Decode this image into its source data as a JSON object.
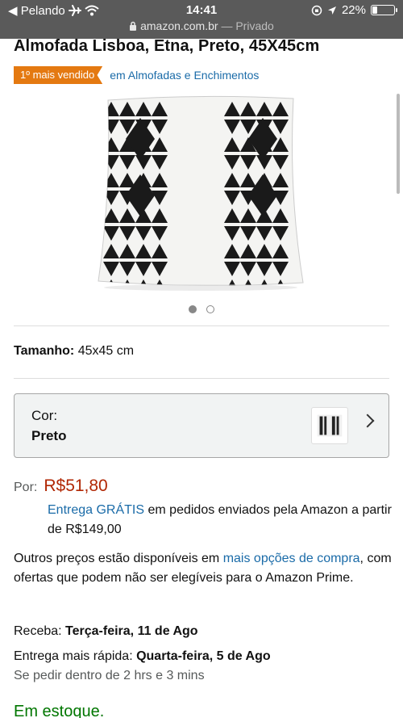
{
  "status_bar": {
    "carrier": "◀ Pelando",
    "time": "14:41",
    "battery": "22%",
    "battery_level": 0.22,
    "url": "amazon.com.br",
    "privacy": "— Privado"
  },
  "product": {
    "title": "Almofada Lisboa, Etna, Preto, 45X45cm",
    "badge": "1º mais vendido",
    "category_link": "em Almofadas e Enchimentos",
    "image_count": 2,
    "active_image": 1
  },
  "size": {
    "label": "Tamanho:",
    "value": "45x45 cm"
  },
  "color": {
    "label": "Cor:",
    "value": "Preto"
  },
  "price": {
    "label": "Por:",
    "value": "R$51,80"
  },
  "delivery": {
    "free_link": "Entrega GRÁTIS",
    "free_text": " em pedidos enviados pela Amazon a partir de R$149,00"
  },
  "other_prices": {
    "prefix": "Outros preços estão disponíveis em ",
    "link": "mais opções de compra",
    "suffix": ", com ofertas que podem não ser elegíveis para o Amazon Prime."
  },
  "shipping": {
    "receive_label": "Receba: ",
    "receive_date": "Terça-feira, 11 de Ago",
    "faster_label": "Entrega mais rápida: ",
    "faster_date": "Quarta-feira, 5 de Ago",
    "cutoff": "Se pedir dentro de 2 hrs e 3 mins"
  },
  "stock": "Em estoque.",
  "colors": {
    "badge": "#e47911",
    "link": "#1a6ba8",
    "price": "#b12704",
    "in_stock": "#007600"
  }
}
